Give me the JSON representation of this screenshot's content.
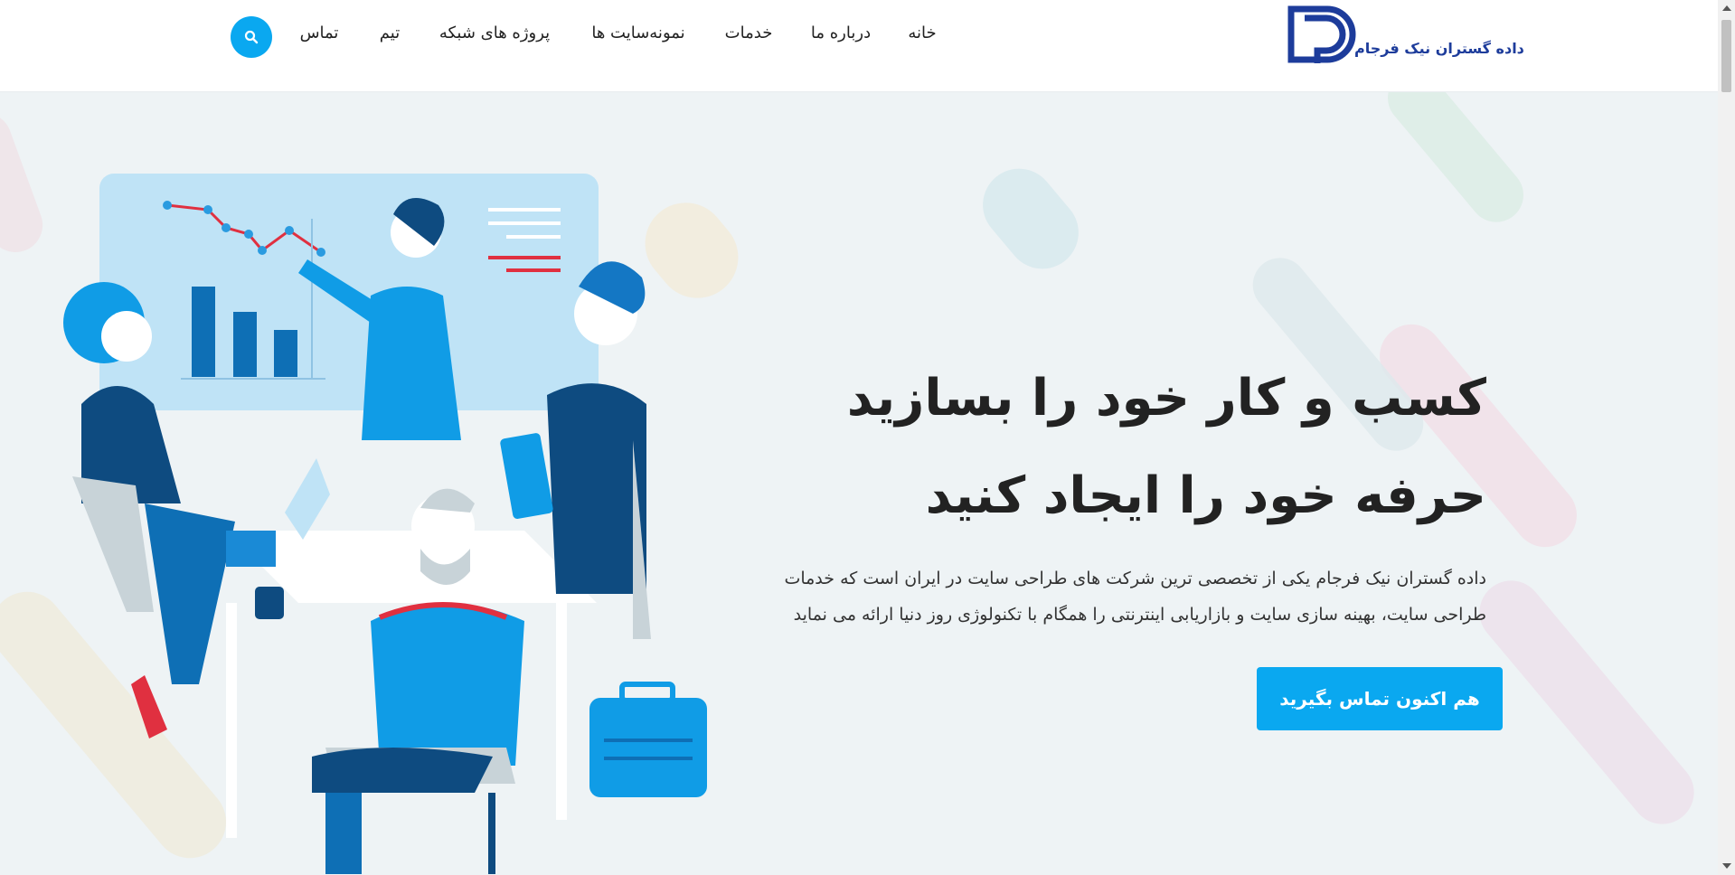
{
  "header": {
    "logo_text": "داده گستران نیک فرجام",
    "nav": [
      {
        "label": "خانه"
      },
      {
        "label": "درباره ما"
      },
      {
        "label": "خدمات"
      },
      {
        "label": "نمونه‌سایت ها"
      },
      {
        "label": "پروژه های شبکه"
      },
      {
        "label": "تیم"
      },
      {
        "label": "تماس"
      }
    ],
    "search_icon": "search-icon"
  },
  "hero": {
    "title_line1": "کسب و کار خود را بسازید",
    "title_line2": "حرفه خود را ایجاد کنید",
    "description_line1": "داده گستران نیک فرجام یکی از تخصصی ترین شرکت های طراحی سایت در ایران است که خدمات",
    "description_line2": "طراحی سایت، بهینه سازی سایت و بازاریابی اینترنتی را همگام با تکنولوژی روز دنیا ارائه می نماید",
    "cta_label": "هم اکنون تماس بگیرید"
  },
  "colors": {
    "accent": "#0aa8f0",
    "logo_blue": "#1d3c9b",
    "hero_bg": "#eef3f5"
  }
}
